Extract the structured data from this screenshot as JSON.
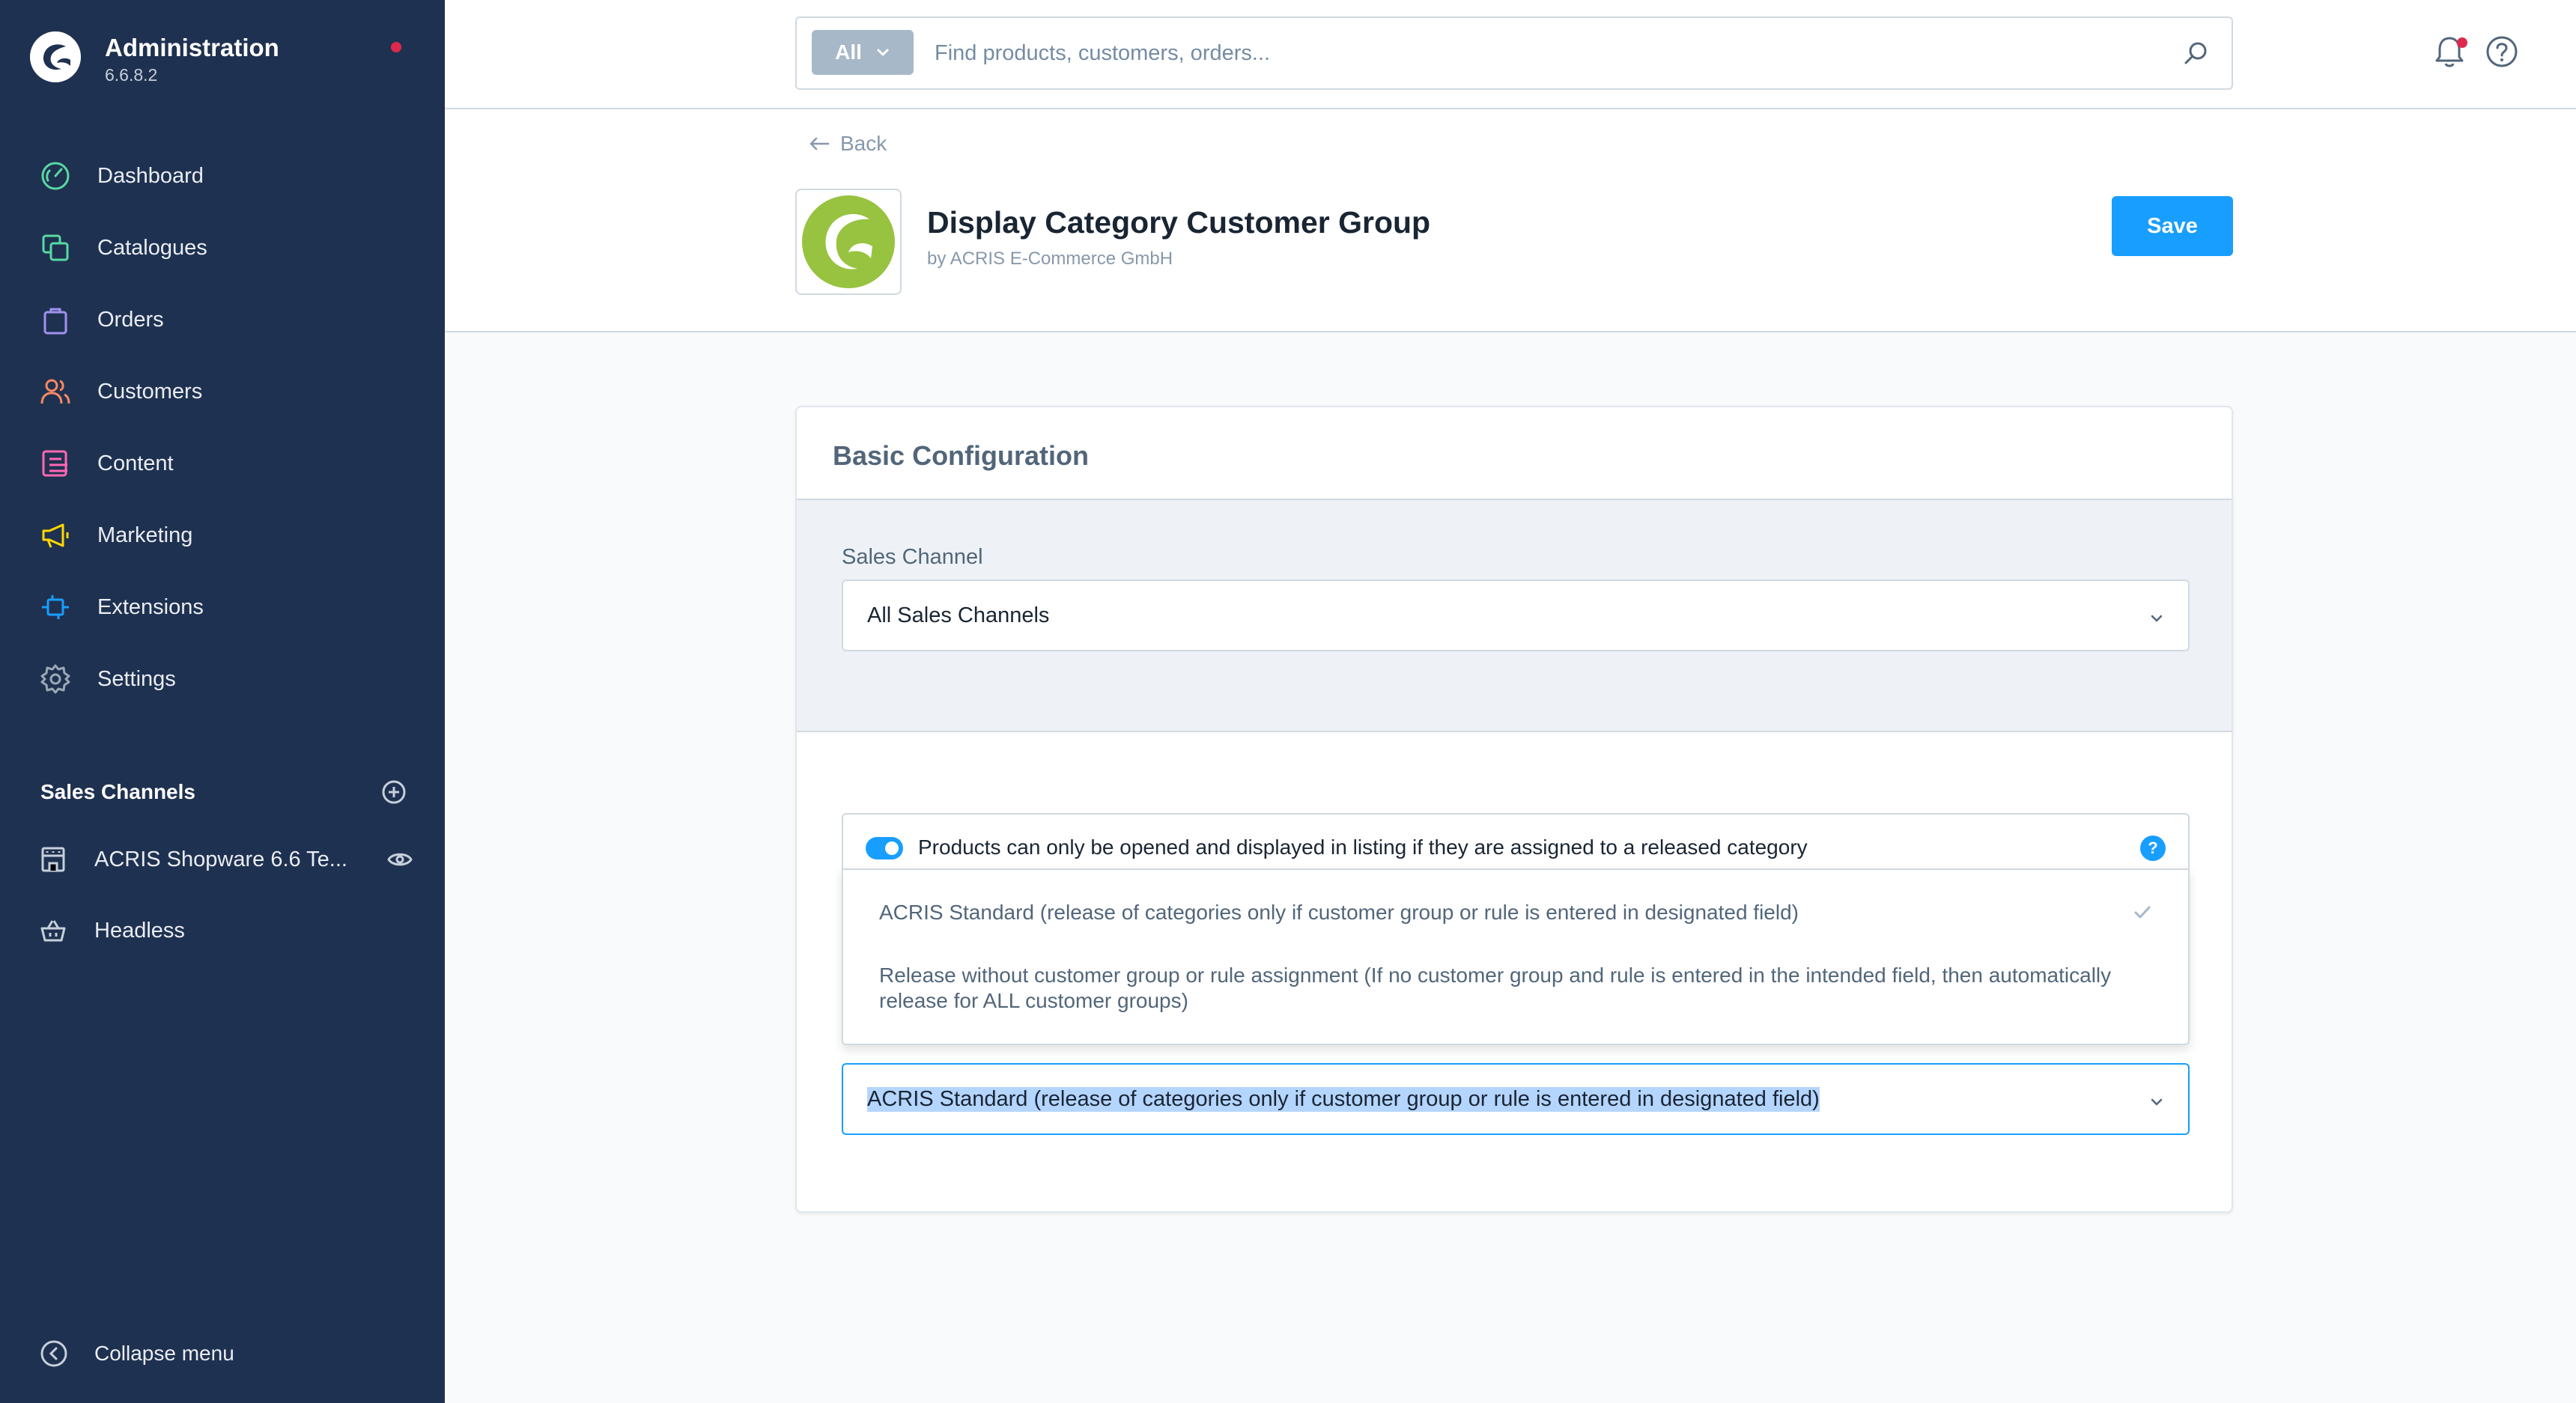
{
  "app": {
    "title": "Administration",
    "version": "6.6.8.2"
  },
  "nav": [
    {
      "label": "Dashboard",
      "icon": "dashboard-icon",
      "color": "#57d9a3"
    },
    {
      "label": "Catalogues",
      "icon": "catalogues-icon",
      "color": "#57d9a3"
    },
    {
      "label": "Orders",
      "icon": "orders-icon",
      "color": "#a092f0"
    },
    {
      "label": "Customers",
      "icon": "customers-icon",
      "color": "#f88962"
    },
    {
      "label": "Content",
      "icon": "content-icon",
      "color": "#ff68b4"
    },
    {
      "label": "Marketing",
      "icon": "marketing-icon",
      "color": "#ffd700"
    },
    {
      "label": "Extensions",
      "icon": "extensions-icon",
      "color": "#189eff"
    },
    {
      "label": "Settings",
      "icon": "settings-icon",
      "color": "#9aa8b5"
    }
  ],
  "sales_channels": {
    "header": "Sales Channels",
    "items": [
      {
        "label": "ACRIS Shopware 6.6 Te..."
      },
      {
        "label": "Headless"
      }
    ]
  },
  "collapse_label": "Collapse menu",
  "search": {
    "type_label": "All",
    "placeholder": "Find products, customers, orders..."
  },
  "smartbar": {
    "back_label": "Back",
    "title": "Display Category Customer Group",
    "author": "by ACRIS E-Commerce GmbH",
    "save_label": "Save"
  },
  "card": {
    "title": "Basic Configuration",
    "sales_channel_label": "Sales Channel",
    "sales_channel_value": "All Sales Channels",
    "switch_label": "Products can only be opened and displayed in listing if they are assigned to a released category",
    "switch_on": true,
    "select_value": "ACRIS Standard (release of categories only if customer group or rule is entered in designated field)",
    "options": [
      {
        "label": "ACRIS Standard (release of categories only if customer group or rule is entered in designated field)",
        "selected": true
      },
      {
        "label": "Release without customer group or rule assignment (If no customer group and rule is entered in the intended field, then automatically release for ALL customer groups)",
        "selected": false
      }
    ]
  },
  "colors": {
    "sidebar_bg": "#1f3150",
    "primary": "#189eff",
    "notification": "#de294c"
  }
}
